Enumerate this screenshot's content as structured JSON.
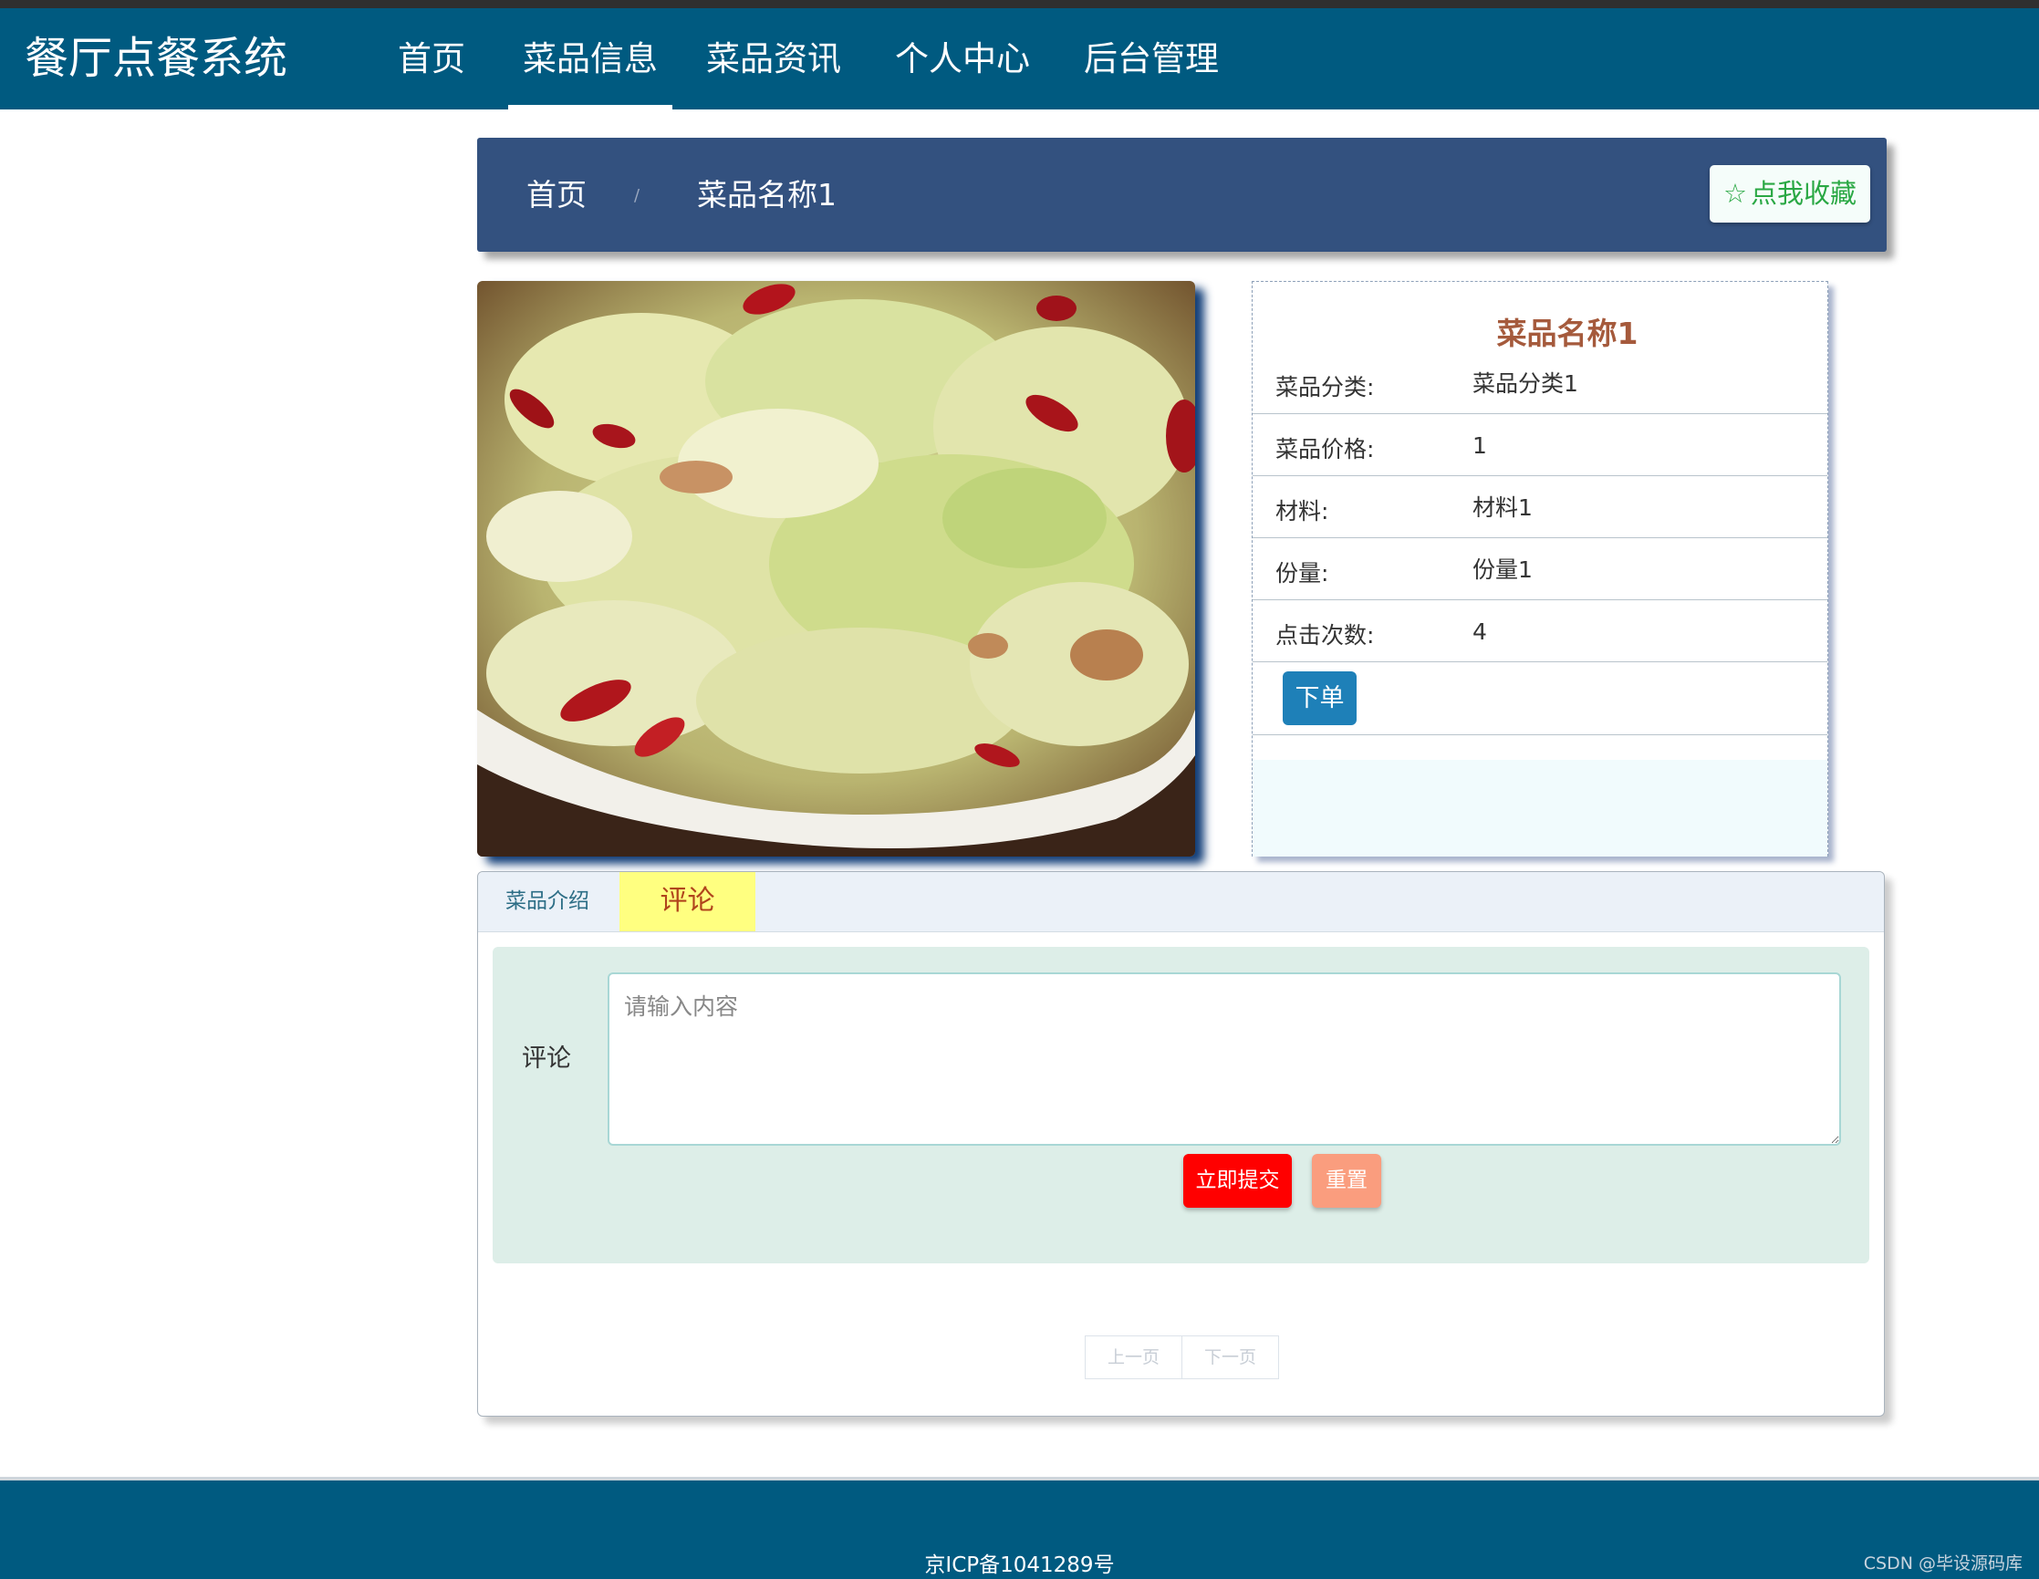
{
  "nav": {
    "brand": "餐厅点餐系统",
    "items": [
      "首页",
      "菜品信息",
      "菜品资讯",
      "个人中心",
      "后台管理"
    ],
    "active_index": 1
  },
  "breadcrumb": {
    "home": "首页",
    "separator": "/",
    "current": "菜品名称1"
  },
  "favorite": {
    "icon": "star-outline-icon",
    "label": "点我收藏"
  },
  "dish": {
    "image_alt": "stir-fried cabbage with dried chili",
    "name": "菜品名称1",
    "fields": [
      {
        "label": "菜品分类:",
        "value": "菜品分类1"
      },
      {
        "label": "菜品价格:",
        "value": "1"
      },
      {
        "label": "材料:",
        "value": "材料1"
      },
      {
        "label": "份量:",
        "value": "份量1"
      },
      {
        "label": "点击次数:",
        "value": "4"
      }
    ],
    "order_label": "下单"
  },
  "tabs": {
    "intro": "菜品介绍",
    "comment": "评论",
    "active": "评论"
  },
  "comment_form": {
    "label": "评论",
    "placeholder": "请输入内容",
    "submit": "立即提交",
    "reset": "重置"
  },
  "pager": {
    "prev": "上一页",
    "next": "下一页"
  },
  "footer": {
    "icp": "京ICP备1041289号",
    "watermark": "CSDN @毕设源码库"
  },
  "colors": {
    "navbar": "#005a80",
    "crumb_bar": "#33517f",
    "title_accent": "#a55a3c",
    "order_button": "#1e80b8",
    "submit_button": "#ff0000",
    "reset_button": "#fa9d7e",
    "active_tab": "#ffff80"
  }
}
